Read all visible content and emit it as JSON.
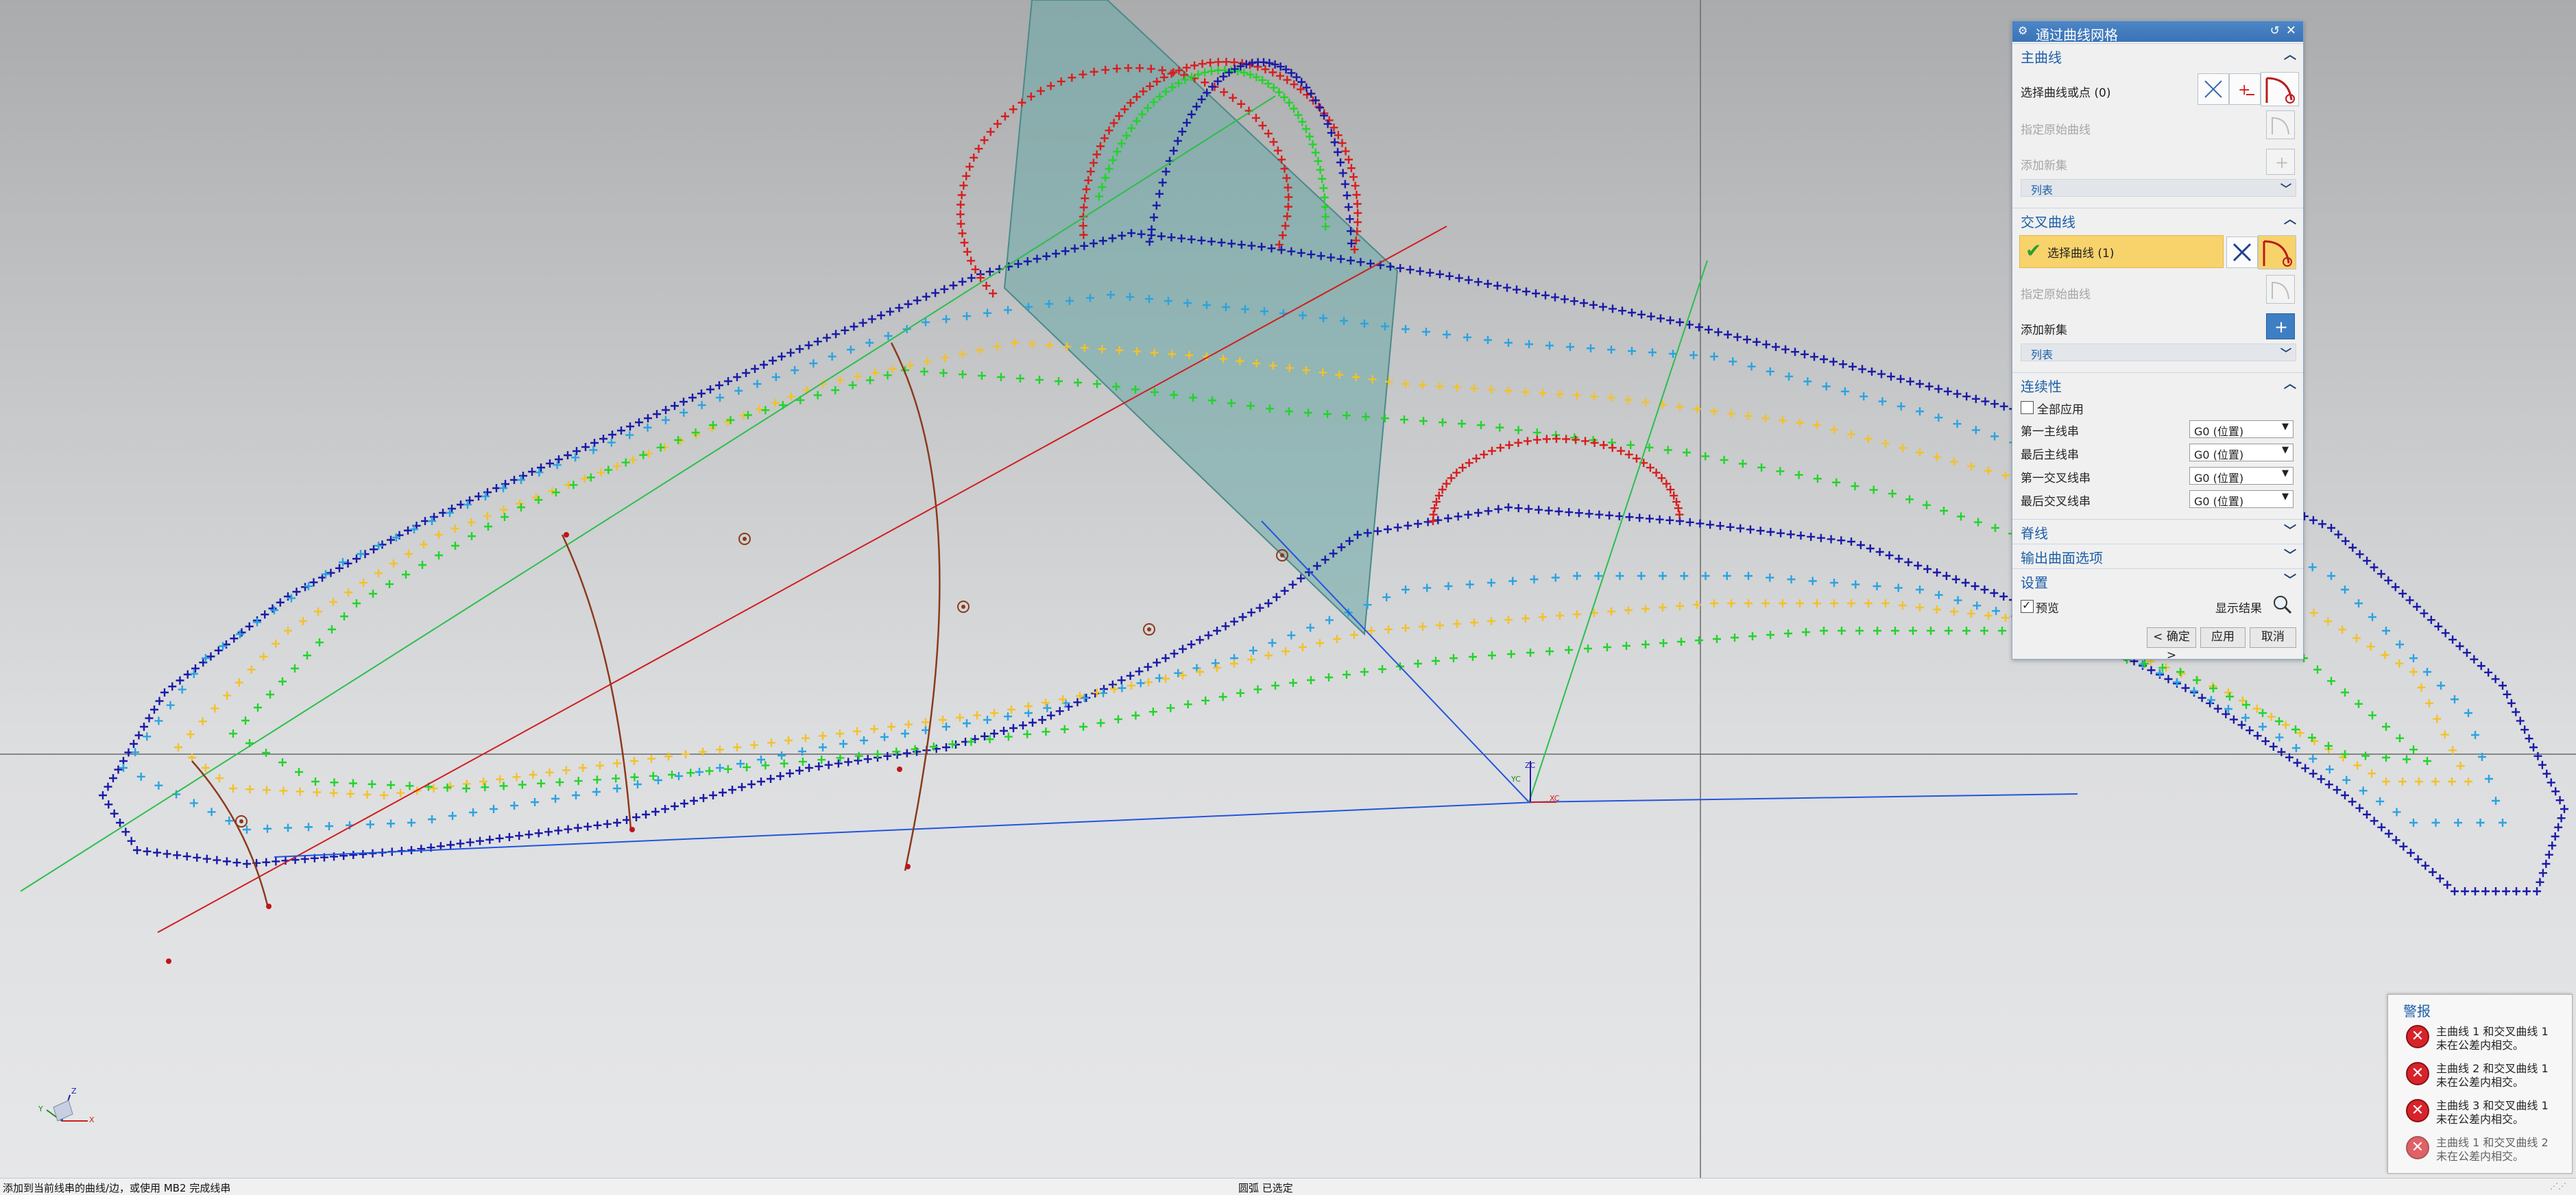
{
  "dialog": {
    "title": "通过曲线网格",
    "primary": {
      "header": "主曲线",
      "select_label": "选择曲线或点 (0)",
      "specify_origin": "指定原始曲线",
      "add_new_set": "添加新集",
      "list": "列表"
    },
    "cross": {
      "header": "交叉曲线",
      "select_label": "选择曲线 (1)",
      "specify_origin": "指定原始曲线",
      "add_new_set": "添加新集",
      "list": "列表"
    },
    "continuity": {
      "header": "连续性",
      "apply_all": "全部应用",
      "rows": [
        {
          "label": "第一主线串",
          "value": "G0 (位置)"
        },
        {
          "label": "最后主线串",
          "value": "G0 (位置)"
        },
        {
          "label": "第一交叉线串",
          "value": "G0 (位置)"
        },
        {
          "label": "最后交叉线串",
          "value": "G0 (位置)"
        }
      ]
    },
    "spine": {
      "header": "脊线"
    },
    "output": {
      "header": "输出曲面选项"
    },
    "settings": {
      "header": "设置"
    },
    "preview": {
      "label": "预览",
      "checked": true,
      "show_result": "显示结果"
    },
    "buttons": {
      "ok": "< 确定 >",
      "apply": "应用",
      "cancel": "取消"
    }
  },
  "alerts": {
    "title": "警报",
    "items": [
      {
        "line1": "主曲线 1 和交叉曲线 1",
        "line2": "未在公差内相交。"
      },
      {
        "line1": "主曲线 2 和交叉曲线 1",
        "line2": "未在公差内相交。"
      },
      {
        "line1": "主曲线 3 和交叉曲线 1",
        "line2": "未在公差内相交。"
      },
      {
        "line1": "主曲线 1 和交叉曲线 2",
        "line2": "未在公差内相交。"
      }
    ]
  },
  "status": {
    "prompt": "添加到当前线串的曲线/边，或使用 MB2 完成线串",
    "selection": "圆弧 已选定"
  },
  "viewport": {
    "csys": {
      "x": "XC",
      "y": "YC",
      "z": "ZC"
    },
    "triad": {
      "x": "X",
      "y": "Y",
      "z": "Z"
    },
    "point_colors": {
      "dark_blue": "#1a1aa8",
      "light_blue": "#2aa3e0",
      "green": "#22d42a",
      "yellow": "#f2c22a",
      "red": "#d81e1e"
    },
    "plane_color": "#6aa8a6"
  }
}
